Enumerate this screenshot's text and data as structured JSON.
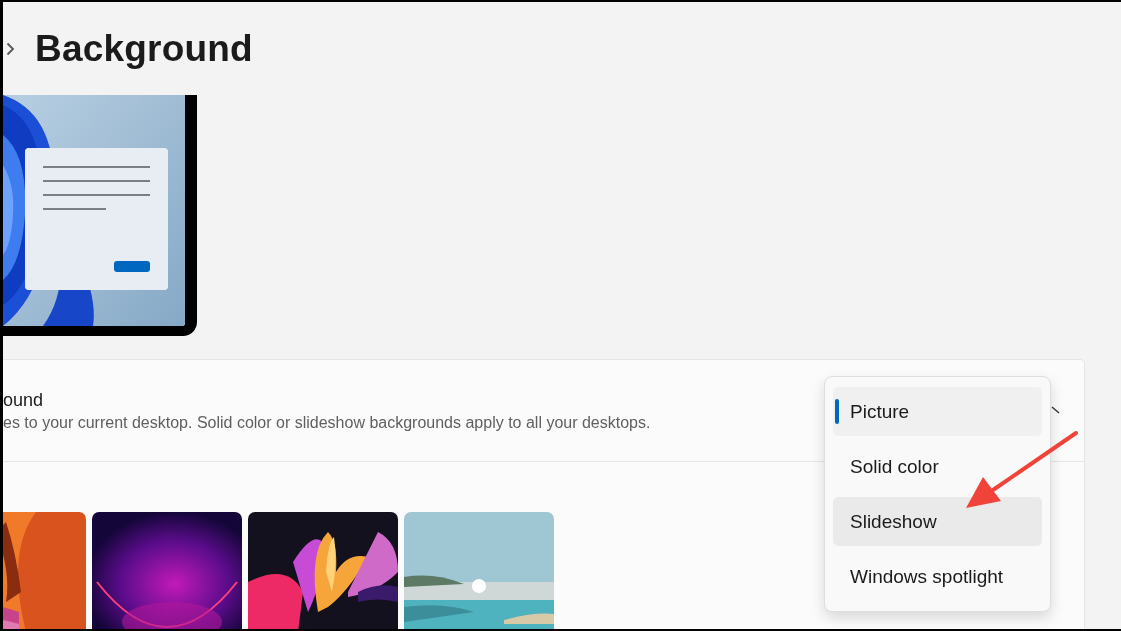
{
  "header": {
    "title": "Background"
  },
  "background_setting": {
    "title": "ound",
    "description": "es to your current desktop. Solid color or slideshow backgrounds apply to all your desktops.",
    "dropdown": {
      "expanded": true,
      "options": [
        {
          "label": "Picture",
          "selected": true,
          "hovered": false
        },
        {
          "label": "Solid color",
          "selected": false,
          "hovered": false
        },
        {
          "label": "Slideshow",
          "selected": false,
          "hovered": true
        },
        {
          "label": "Windows spotlight",
          "selected": false,
          "hovered": false
        }
      ]
    }
  }
}
